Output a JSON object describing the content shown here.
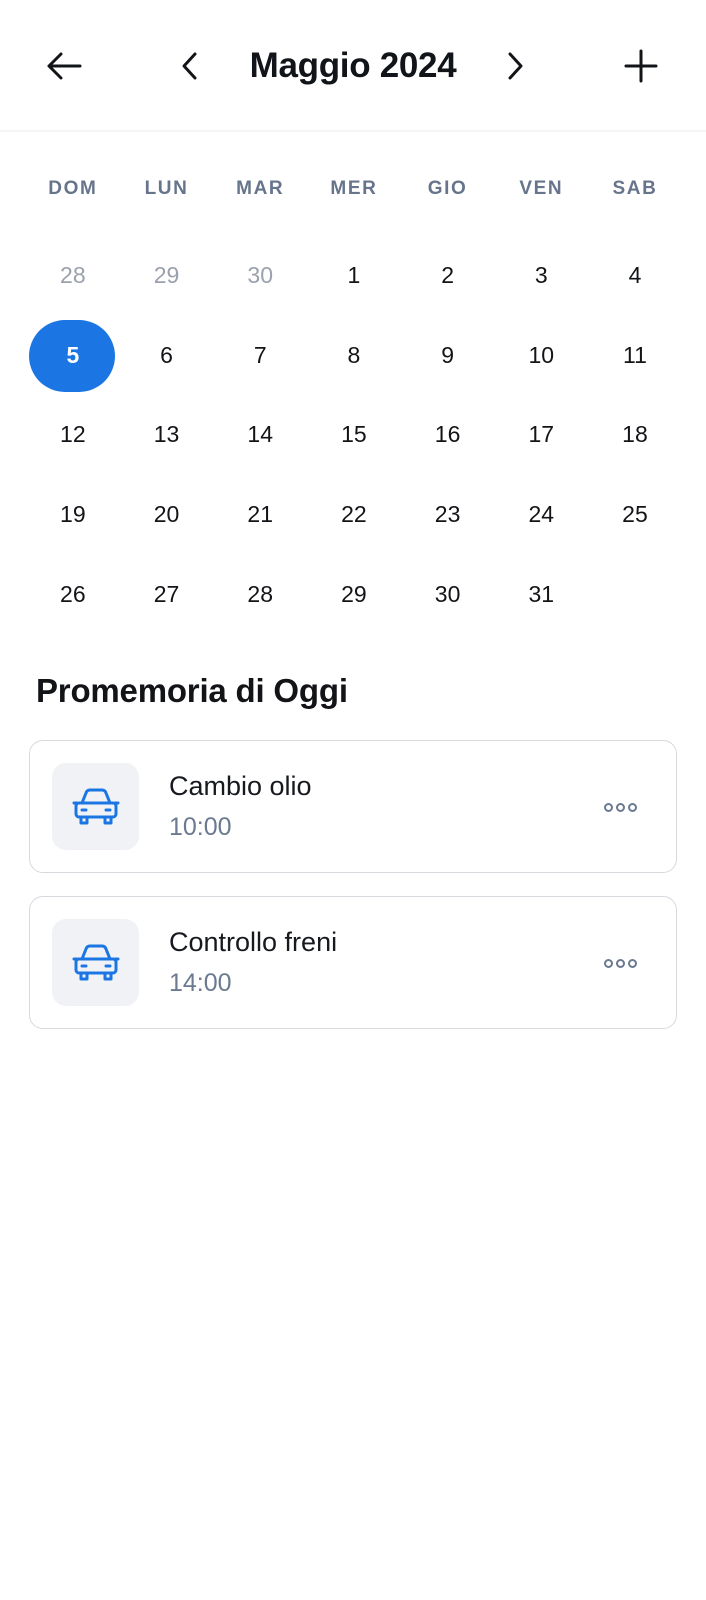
{
  "header": {
    "title": "Maggio 2024",
    "back_icon": "arrow-left-icon",
    "prev_icon": "chevron-left-icon",
    "next_icon": "chevron-right-icon",
    "add_icon": "plus-icon"
  },
  "calendar": {
    "weekdays": [
      "DOM",
      "LUN",
      "MAR",
      "MER",
      "GIO",
      "VEN",
      "SAB"
    ],
    "days": [
      {
        "label": "28",
        "muted": true
      },
      {
        "label": "29",
        "muted": true
      },
      {
        "label": "30",
        "muted": true
      },
      {
        "label": "1"
      },
      {
        "label": "2"
      },
      {
        "label": "3"
      },
      {
        "label": "4"
      },
      {
        "label": "5",
        "selected": true
      },
      {
        "label": "6"
      },
      {
        "label": "7"
      },
      {
        "label": "8"
      },
      {
        "label": "9"
      },
      {
        "label": "10"
      },
      {
        "label": "11"
      },
      {
        "label": "12"
      },
      {
        "label": "13"
      },
      {
        "label": "14"
      },
      {
        "label": "15"
      },
      {
        "label": "16"
      },
      {
        "label": "17"
      },
      {
        "label": "18"
      },
      {
        "label": "19"
      },
      {
        "label": "20"
      },
      {
        "label": "21"
      },
      {
        "label": "22"
      },
      {
        "label": "23"
      },
      {
        "label": "24"
      },
      {
        "label": "25"
      },
      {
        "label": "26"
      },
      {
        "label": "27"
      },
      {
        "label": "28"
      },
      {
        "label": "29"
      },
      {
        "label": "30"
      },
      {
        "label": "31"
      }
    ],
    "selected_color": "#1b76e4"
  },
  "reminders": {
    "section_title": "Promemoria di Oggi",
    "items": [
      {
        "title": "Cambio olio",
        "time": "10:00",
        "icon": "car-icon"
      },
      {
        "title": "Controllo freni",
        "time": "14:00",
        "icon": "car-icon"
      }
    ],
    "more_icon": "more-dots-icon"
  },
  "colors": {
    "accent": "#1b76e4",
    "muted_text": "#6b7a90"
  }
}
